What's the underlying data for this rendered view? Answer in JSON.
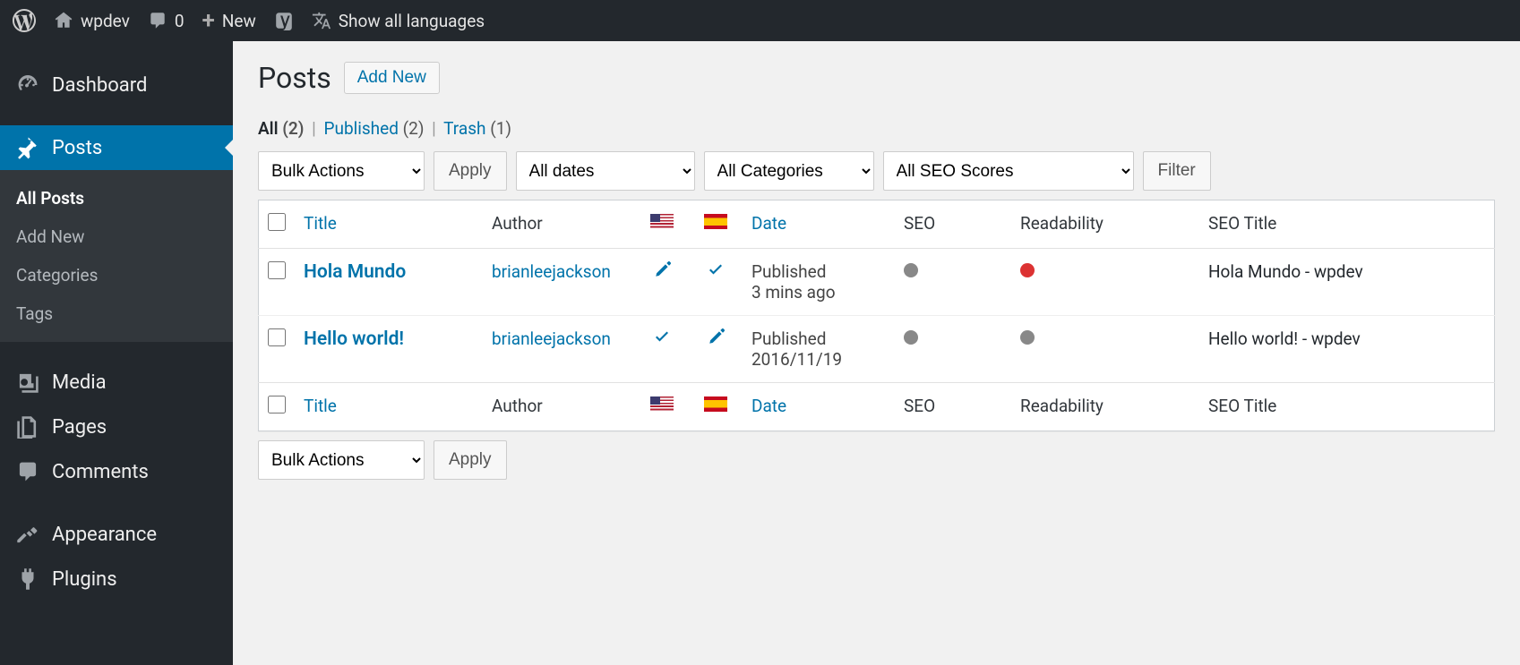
{
  "adminbar": {
    "site_name": "wpdev",
    "comments_count": "0",
    "new_label": "New",
    "show_langs": "Show all languages"
  },
  "sidebar": {
    "dashboard": "Dashboard",
    "posts": "Posts",
    "media": "Media",
    "pages": "Pages",
    "comments": "Comments",
    "appearance": "Appearance",
    "plugins": "Plugins",
    "submenu": {
      "all_posts": "All Posts",
      "add_new": "Add New",
      "categories": "Categories",
      "tags": "Tags"
    }
  },
  "page": {
    "title": "Posts",
    "add_new": "Add New"
  },
  "filters": {
    "name": [
      "All",
      "Published",
      "Trash"
    ],
    "count": [
      "(2)",
      "(2)",
      "(1)"
    ]
  },
  "controls": {
    "bulk": "Bulk Actions",
    "apply": "Apply",
    "dates": "All dates",
    "cats": "All Categories",
    "seo": "All SEO Scores",
    "filter": "Filter"
  },
  "columns": {
    "title": "Title",
    "author": "Author",
    "date": "Date",
    "seo": "SEO",
    "readability": "Readability",
    "seo_title": "SEO Title"
  },
  "rows": [
    {
      "title": "Hola Mundo",
      "author": "brianleejackson",
      "date_status": "Published",
      "date_value": "3 mins ago",
      "seo_title": "Hola Mundo - wpdev",
      "us": "pencil",
      "es": "check",
      "seo_dot": "gray",
      "read_dot": "red"
    },
    {
      "title": "Hello world!",
      "author": "brianleejackson",
      "date_status": "Published",
      "date_value": "2016/11/19",
      "seo_title": "Hello world! - wpdev",
      "us": "check",
      "es": "pencil",
      "seo_dot": "gray",
      "read_dot": "gray"
    }
  ]
}
